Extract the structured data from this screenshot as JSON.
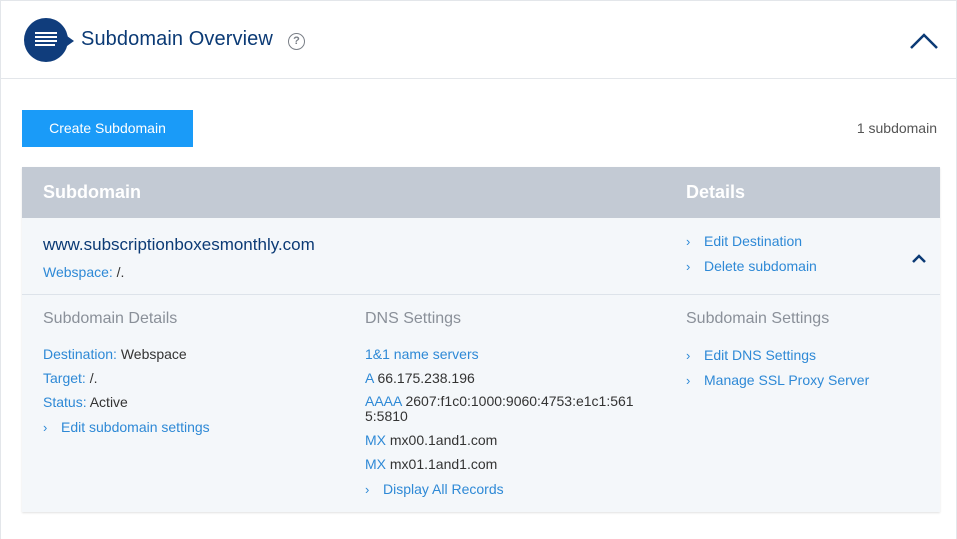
{
  "header": {
    "title": "Subdomain Overview",
    "help_glyph": "?",
    "icon": "subdomain-list-icon",
    "collapse_icon": "chevron-up-icon"
  },
  "toolbar": {
    "create_label": "Create Subdomain",
    "count_label": "1 subdomain"
  },
  "table": {
    "headers": {
      "subdomain": "Subdomain",
      "details": "Details"
    },
    "row": {
      "domain": "www.subscriptionboxesmonthly.com",
      "webspace_label": "Webspace:",
      "webspace_value": "/.",
      "actions": [
        "Edit Destination",
        "Delete subdomain"
      ]
    },
    "detail": {
      "subdomain_details": {
        "title": "Subdomain Details",
        "destination_label": "Destination:",
        "destination_value": "Webspace",
        "target_label": "Target:",
        "target_value": "/.",
        "status_label": "Status:",
        "status_value": "Active",
        "edit_link": "Edit subdomain settings"
      },
      "dns_settings": {
        "title": "DNS Settings",
        "nameservers": "1&1 name servers",
        "a_label": "A",
        "a_value": "66.175.238.196",
        "aaaa_label": "AAAA",
        "aaaa_value_1": "2607:f1c0:1000:9060:4753:e1c1:561",
        "aaaa_value_2": "5:5810",
        "mx1_label": "MX",
        "mx1_value": "mx00.1and1.com",
        "mx2_label": "MX",
        "mx2_value": "mx01.1and1.com",
        "display_all": "Display All Records"
      },
      "subdomain_settings": {
        "title": "Subdomain Settings",
        "links": [
          "Edit DNS Settings",
          "Manage SSL Proxy Server"
        ]
      }
    }
  },
  "colors": {
    "brand_dark": "#0b3a75",
    "link": "#2e89d6",
    "button": "#1a9bf8",
    "table_header": "#c3cad4",
    "row_bg": "#f4f7fa"
  }
}
